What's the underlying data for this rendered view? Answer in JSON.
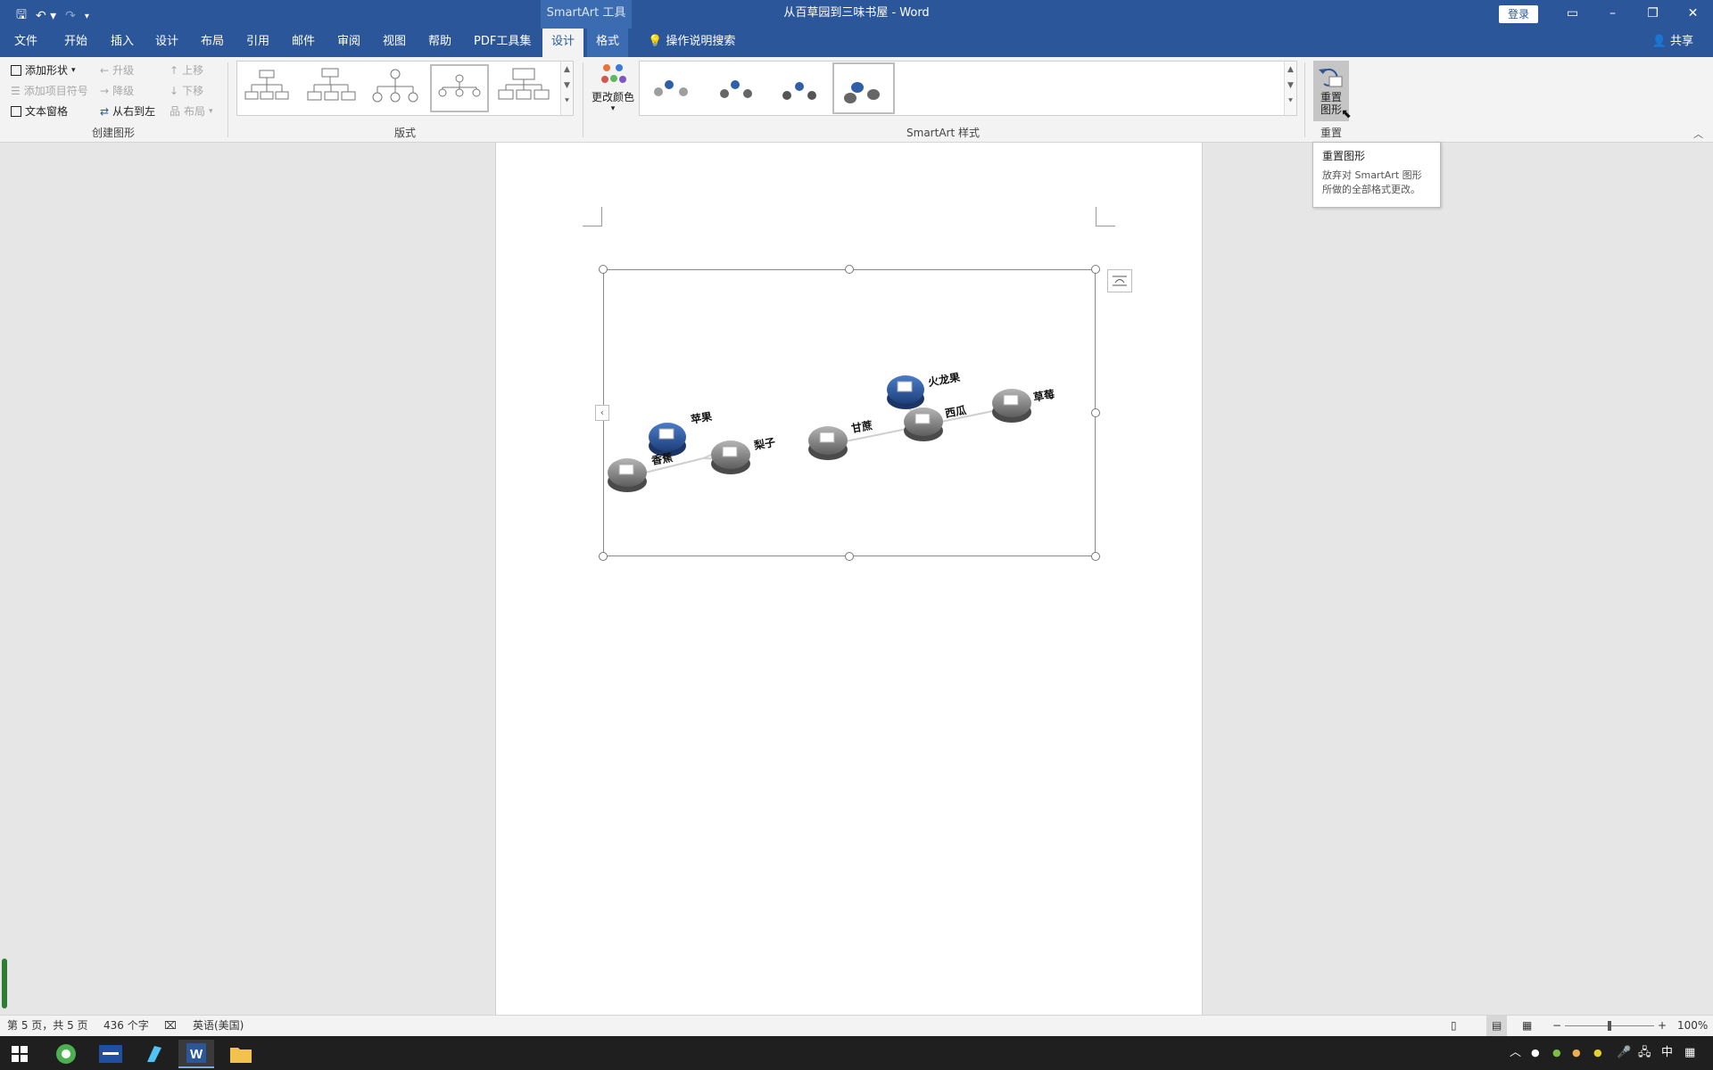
{
  "window": {
    "title": "从百草园到三味书屋  -  Word",
    "context_tool": "SmartArt 工具",
    "login_label": "登录",
    "controls": [
      "▭",
      "–",
      "❐",
      "✕"
    ]
  },
  "quick_access": [
    "save-icon",
    "undo-icon",
    "redo-icon",
    "customize-icon"
  ],
  "tabs": [
    "文件",
    "开始",
    "插入",
    "设计",
    "布局",
    "引用",
    "邮件",
    "审阅",
    "视图",
    "帮助",
    "PDF工具集",
    "设计",
    "格式"
  ],
  "tell_me": "操作说明搜索",
  "share": "共享",
  "ribbon": {
    "create_group": {
      "label": "创建图形",
      "add_shape": "添加形状",
      "add_bullet": "添加项目符号",
      "text_pane": "文本窗格",
      "promote": "升级",
      "demote": "降级",
      "rtl": "从右到左",
      "move_up": "上移",
      "move_down": "下移",
      "layout": "布局"
    },
    "layouts_group": {
      "label": "版式"
    },
    "styles_group": {
      "label": "SmartArt 样式",
      "change_colors": "更改颜色"
    },
    "reset_group": {
      "label": "重置",
      "reset_graphic_line1": "重置",
      "reset_graphic_line2": "图形"
    }
  },
  "tooltip": {
    "title": "重置图形",
    "line1": "放弃对 SmartArt 图形",
    "line2": "所做的全部格式更改。"
  },
  "smartart": {
    "nodes": [
      {
        "label": "香蕉",
        "color": "gray"
      },
      {
        "label": "苹果",
        "color": "blue"
      },
      {
        "label": "梨子",
        "color": "gray"
      },
      {
        "label": "甘蔗",
        "color": "gray"
      },
      {
        "label": "火龙果",
        "color": "blue"
      },
      {
        "label": "西瓜",
        "color": "gray"
      },
      {
        "label": "草莓",
        "color": "gray"
      }
    ]
  },
  "statusbar": {
    "page": "第 5 页，共 5 页",
    "words": "436 个字",
    "language": "英语(美国)",
    "zoom": "100%"
  },
  "taskbar": {
    "apps": [
      "start-icon",
      "browser-icon",
      "app-icon",
      "notes-icon",
      "word-icon",
      "folder-icon"
    ],
    "ime": "中"
  },
  "colors": {
    "brand": "#2b579a",
    "node_blue": "#2f5fa8",
    "node_gray": "#8a8a8a"
  }
}
